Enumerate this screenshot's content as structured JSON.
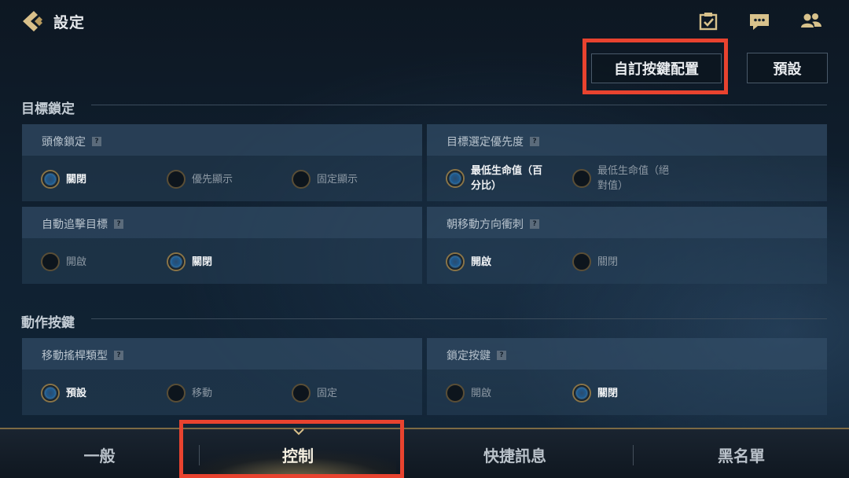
{
  "header": {
    "title": "設定",
    "icons": [
      "back-chevron-icon",
      "calendar-check-icon",
      "chat-bubble-icon",
      "friends-icon"
    ]
  },
  "actions": {
    "custom_keys_label": "自訂按鍵配置",
    "default_label": "預設"
  },
  "sections": {
    "target_lock": {
      "title": "目標鎖定",
      "panels": {
        "avatar_lock": {
          "label": "頭像鎖定",
          "options": [
            "關閉",
            "優先顯示",
            "固定顯示"
          ],
          "selected": "關閉"
        },
        "target_priority": {
          "label": "目標選定優先度",
          "options": [
            "最低生命值（百分比）",
            "最低生命值（絕對值）"
          ],
          "option_lines": [
            [
              "最低生命值（百",
              "分比）"
            ],
            [
              "最低生命值（絕",
              "對值）"
            ]
          ],
          "selected": "最低生命值（百分比）"
        },
        "auto_chase": {
          "label": "自動追擊目標",
          "options": [
            "開啟",
            "關閉"
          ],
          "selected": "關閉"
        },
        "dash_direction": {
          "label": "朝移動方向衝刺",
          "options": [
            "開啟",
            "關閉"
          ],
          "selected": "開啟"
        }
      }
    },
    "action_keys": {
      "title": "動作按鍵",
      "panels": {
        "joystick_type": {
          "label": "移動搖桿類型",
          "options": [
            "預設",
            "移動",
            "固定"
          ],
          "selected": "預設"
        },
        "lock_button": {
          "label": "鎖定按鍵",
          "options": [
            "開啟",
            "關閉"
          ],
          "selected": "關閉"
        }
      }
    }
  },
  "tabs": [
    {
      "label": "一般"
    },
    {
      "label": "控制",
      "active": true
    },
    {
      "label": "快捷訊息"
    },
    {
      "label": "黑名單"
    }
  ],
  "colors": {
    "highlight": "#e8432f",
    "gold_accent": "#c9b37e",
    "radio_on": "#4f9fdb"
  }
}
